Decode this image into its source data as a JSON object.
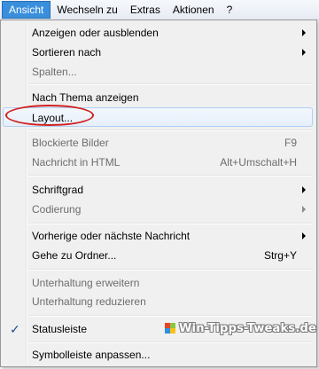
{
  "menubar": {
    "items": [
      {
        "label": "Ansicht"
      },
      {
        "label": "Wechseln zu"
      },
      {
        "label": "Extras"
      },
      {
        "label": "Aktionen"
      },
      {
        "label": "?"
      }
    ]
  },
  "menu": {
    "items": [
      {
        "label": "Anzeigen oder ausblenden"
      },
      {
        "label": "Sortieren nach"
      },
      {
        "label": "Spalten..."
      },
      {
        "label": "Nach Thema anzeigen"
      },
      {
        "label": "Layout..."
      },
      {
        "label": "Blockierte Bilder",
        "shortcut": "F9"
      },
      {
        "label": "Nachricht in HTML",
        "shortcut": "Alt+Umschalt+H"
      },
      {
        "label": "Schriftgrad"
      },
      {
        "label": "Codierung"
      },
      {
        "label": "Vorherige oder nächste Nachricht"
      },
      {
        "label": "Gehe zu Ordner...",
        "shortcut": "Strg+Y"
      },
      {
        "label": "Unterhaltung erweitern"
      },
      {
        "label": "Unterhaltung reduzieren"
      },
      {
        "label": "Statusleiste",
        "check": "✓"
      },
      {
        "label": "Symbolleiste anpassen..."
      }
    ]
  },
  "watermark": {
    "text": "Win-Tipps-Tweaks.de"
  },
  "colors": {
    "menubar_active": "#3a8fdc",
    "highlight_border": "#aecff7",
    "annotation_oval": "#d02020",
    "disabled_text": "#6d6d6d"
  }
}
